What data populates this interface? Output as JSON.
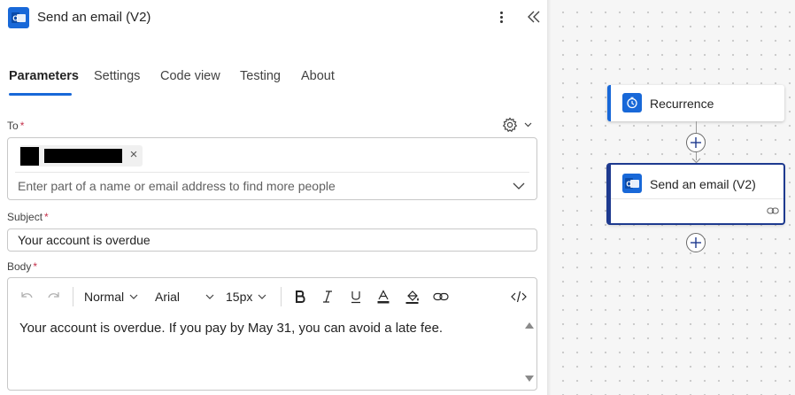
{
  "header": {
    "title": "Send an email (V2)",
    "icon": "outlook-icon"
  },
  "tabs": [
    {
      "label": "Parameters",
      "active": true
    },
    {
      "label": "Settings",
      "active": false
    },
    {
      "label": "Code view",
      "active": false
    },
    {
      "label": "Testing",
      "active": false
    },
    {
      "label": "About",
      "active": false
    }
  ],
  "fields": {
    "to": {
      "label": "To",
      "required_mark": "*",
      "placeholder": "Enter part of a name or email address to find more people",
      "chip_remove": "×"
    },
    "subject": {
      "label": "Subject",
      "required_mark": "*",
      "value": "Your account is overdue"
    },
    "body": {
      "label": "Body",
      "required_mark": "*",
      "toolbar": {
        "style": "Normal",
        "font": "Arial",
        "size": "15px"
      },
      "value": "Your account is overdue. If you pay by May 31, you can avoid a late fee."
    }
  },
  "canvas": {
    "nodes": [
      {
        "title": "Recurrence",
        "icon": "clock-icon"
      },
      {
        "title": "Send an email (V2)",
        "icon": "outlook-icon",
        "selected": true
      }
    ]
  },
  "colors": {
    "accent": "#1868d8",
    "selected_border": "#1e3a8f",
    "required": "#c4314b"
  }
}
